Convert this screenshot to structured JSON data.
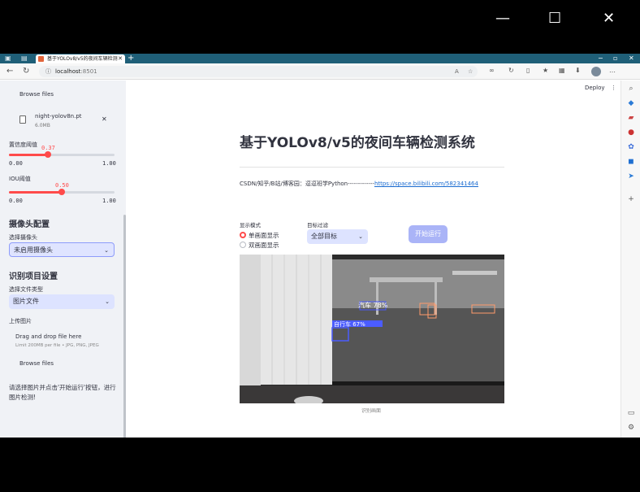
{
  "window": {
    "minimize": "—",
    "maximize": "☐",
    "close": "✕"
  },
  "browser": {
    "tab_title": "基于YOLOv8/v5的夜间车辆检测",
    "tab_close": "✕",
    "new_tab": "+",
    "url_host": "localhost",
    "url_port": ":8501",
    "deploy": "Deploy",
    "menu": "⋮"
  },
  "sidebar": {
    "browse_top": "Browse files",
    "file_name": "night-yolov8n.pt",
    "file_size": "6.0MB",
    "file_close": "✕",
    "conf_label": "置信度阈值",
    "conf_value": "0.37",
    "conf_min": "0.00",
    "conf_max": "1.00",
    "iou_label": "IOU阈值",
    "iou_value": "0.50",
    "iou_min": "0.00",
    "iou_max": "1.00",
    "camera_header": "摄像头配置",
    "camera_label": "选择摄像头",
    "camera_value": "未启用摄像头",
    "project_header": "识别项目设置",
    "filetype_label": "选择文件类型",
    "filetype_value": "图片文件",
    "upload_label": "上传图片",
    "drag_drop": "Drag and drop file here",
    "limit": "Limit 200MB per file • JPG, PNG, JPEG",
    "browse_bottom": "Browse files",
    "hint": "请选择图片并点击'开始运行'按钮，进行图片检测!"
  },
  "main": {
    "title": "基于YOLOv8/v5的夜间车辆检测系统",
    "csdn_text": "CSDN/知乎/B站/博客园：逗逗班学Python-------------",
    "csdn_link": "https://space.bilibili.com/582341464",
    "display_mode_label": "显示模式",
    "radio_single": "单画面显示",
    "radio_double": "双画面显示",
    "target_filter_label": "目标过滤",
    "target_filter_value": "全部目标",
    "run_button": "开始运行",
    "image_caption": "识别画面",
    "detections": [
      {
        "label": "汽车 78%"
      },
      {
        "label": "自行车 67%"
      }
    ]
  }
}
